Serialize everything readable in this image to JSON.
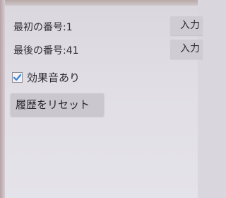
{
  "settings": {
    "first_number_label": "最初の番号:1",
    "last_number_label": "最後の番号:41",
    "input_button_1": "入力",
    "input_button_2": "入力",
    "sound_effect_label": "効果音あり",
    "sound_effect_checked": true,
    "reset_button_label": "履歴をリセット",
    "accent_color": "#3a83d6"
  }
}
